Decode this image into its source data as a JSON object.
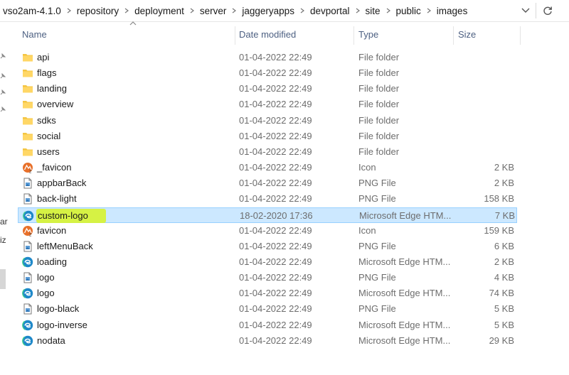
{
  "breadcrumb": [
    "vso2am-4.1.0",
    "repository",
    "deployment",
    "server",
    "jaggeryapps",
    "devportal",
    "site",
    "public",
    "images"
  ],
  "columns": {
    "name": "Name",
    "date": "Date modified",
    "type": "Type",
    "size": "Size"
  },
  "nav_fragments": [
    "ar",
    "iz"
  ],
  "colors": {
    "selection_bg": "#cce8ff",
    "selection_border": "#99d1ff",
    "highlight": "#d6f23a",
    "folder": "#f4c542"
  },
  "files": [
    {
      "name": "api",
      "date": "01-04-2022 22:49",
      "type": "File folder",
      "size": "",
      "icon": "folder-icon"
    },
    {
      "name": "flags",
      "date": "01-04-2022 22:49",
      "type": "File folder",
      "size": "",
      "icon": "folder-icon"
    },
    {
      "name": "landing",
      "date": "01-04-2022 22:49",
      "type": "File folder",
      "size": "",
      "icon": "folder-icon"
    },
    {
      "name": "overview",
      "date": "01-04-2022 22:49",
      "type": "File folder",
      "size": "",
      "icon": "folder-icon"
    },
    {
      "name": "sdks",
      "date": "01-04-2022 22:49",
      "type": "File folder",
      "size": "",
      "icon": "folder-icon"
    },
    {
      "name": "social",
      "date": "01-04-2022 22:49",
      "type": "File folder",
      "size": "",
      "icon": "folder-icon"
    },
    {
      "name": "users",
      "date": "01-04-2022 22:49",
      "type": "File folder",
      "size": "",
      "icon": "folder-icon"
    },
    {
      "name": "_favicon",
      "date": "01-04-2022 22:49",
      "type": "Icon",
      "size": "2 KB",
      "icon": "ico-file-icon"
    },
    {
      "name": "appbarBack",
      "date": "01-04-2022 22:49",
      "type": "PNG File",
      "size": "2 KB",
      "icon": "png-file-icon"
    },
    {
      "name": "back-light",
      "date": "01-04-2022 22:49",
      "type": "PNG File",
      "size": "158 KB",
      "icon": "png-file-icon"
    },
    {
      "name": "custom-logo",
      "date": "18-02-2020 17:36",
      "type": "Microsoft Edge HTM...",
      "size": "7 KB",
      "icon": "edge-file-icon",
      "selected": true,
      "highlighted": true
    },
    {
      "name": "favicon",
      "date": "01-04-2022 22:49",
      "type": "Icon",
      "size": "159 KB",
      "icon": "ico-file-icon"
    },
    {
      "name": "leftMenuBack",
      "date": "01-04-2022 22:49",
      "type": "PNG File",
      "size": "6 KB",
      "icon": "png-file-icon"
    },
    {
      "name": "loading",
      "date": "01-04-2022 22:49",
      "type": "Microsoft Edge HTM...",
      "size": "2 KB",
      "icon": "edge-file-icon"
    },
    {
      "name": "logo",
      "date": "01-04-2022 22:49",
      "type": "PNG File",
      "size": "4 KB",
      "icon": "png-file-icon"
    },
    {
      "name": "logo",
      "date": "01-04-2022 22:49",
      "type": "Microsoft Edge HTM...",
      "size": "74 KB",
      "icon": "edge-file-icon"
    },
    {
      "name": "logo-black",
      "date": "01-04-2022 22:49",
      "type": "PNG File",
      "size": "5 KB",
      "icon": "png-file-icon"
    },
    {
      "name": "logo-inverse",
      "date": "01-04-2022 22:49",
      "type": "Microsoft Edge HTM...",
      "size": "5 KB",
      "icon": "edge-file-icon"
    },
    {
      "name": "nodata",
      "date": "01-04-2022 22:49",
      "type": "Microsoft Edge HTM...",
      "size": "29 KB",
      "icon": "edge-file-icon"
    }
  ]
}
